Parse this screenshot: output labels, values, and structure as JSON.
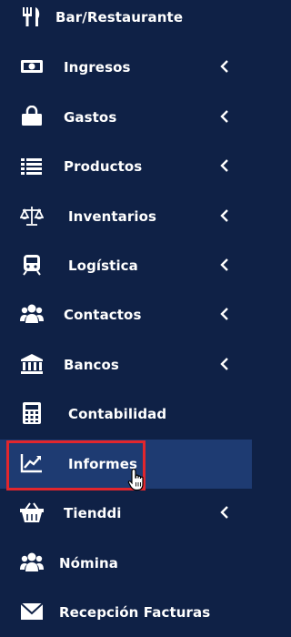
{
  "sidebar": {
    "items": [
      {
        "label": "Bar/Restaurante",
        "icon": "cutlery-icon",
        "has_submenu": false
      },
      {
        "label": "Ingresos",
        "icon": "money-bill-icon",
        "has_submenu": true
      },
      {
        "label": "Gastos",
        "icon": "shopping-bag-icon",
        "has_submenu": true
      },
      {
        "label": "Productos",
        "icon": "list-icon",
        "has_submenu": true
      },
      {
        "label": "Inventarios",
        "icon": "balance-scale-icon",
        "has_submenu": true
      },
      {
        "label": "Logística",
        "icon": "train-icon",
        "has_submenu": true
      },
      {
        "label": "Contactos",
        "icon": "users-icon",
        "has_submenu": true
      },
      {
        "label": "Bancos",
        "icon": "bank-icon",
        "has_submenu": true
      },
      {
        "label": "Contabilidad",
        "icon": "calculator-icon",
        "has_submenu": false
      },
      {
        "label": "Informes",
        "icon": "line-chart-icon",
        "has_submenu": false,
        "active": true
      },
      {
        "label": "Tienddi",
        "icon": "basket-icon",
        "has_submenu": true
      },
      {
        "label": "Nómina",
        "icon": "users-icon",
        "has_submenu": false
      },
      {
        "label": "Recepción Facturas",
        "icon": "envelope-icon",
        "has_submenu": false
      }
    ]
  },
  "colors": {
    "background": "#0f2146",
    "active": "#1e3b72",
    "highlight": "#e1262d",
    "text": "#ffffff"
  }
}
